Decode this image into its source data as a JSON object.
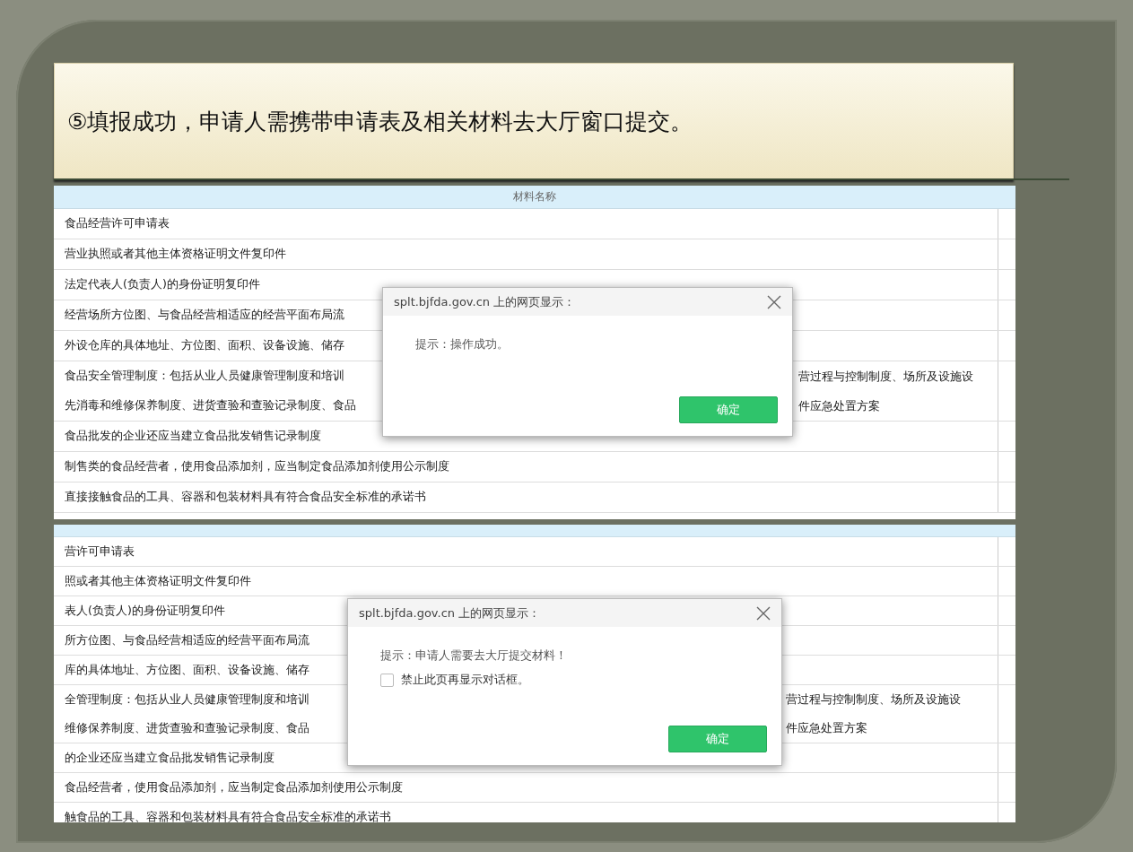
{
  "slide": {
    "title": "⑤填报成功，申请人需携带申请表及相关材料去大厅窗口提交。"
  },
  "screenshots": [
    {
      "header": "材料名称",
      "rows": [
        {
          "lines": [
            {
              "left": "食品经营许可申请表"
            }
          ]
        },
        {
          "lines": [
            {
              "left": "营业执照或者其他主体资格证明文件复印件"
            }
          ]
        },
        {
          "lines": [
            {
              "left": "法定代表人(负责人)的身份证明复印件"
            }
          ]
        },
        {
          "lines": [
            {
              "left": "经营场所方位图、与食品经营相适应的经营平面布局流"
            }
          ]
        },
        {
          "lines": [
            {
              "left": "外设仓库的具体地址、方位图、面积、设备设施、储存"
            }
          ]
        },
        {
          "lines": [
            {
              "left": "食品安全管理制度：包括从业人员健康管理制度和培训",
              "right": "营过程与控制制度、场所及设施设"
            },
            {
              "left": "先消毒和维修保养制度、进货查验和查验记录制度、食品",
              "right": "件应急处置方案"
            }
          ]
        },
        {
          "lines": [
            {
              "left": "食品批发的企业还应当建立食品批发销售记录制度"
            }
          ]
        },
        {
          "lines": [
            {
              "left": "制售类的食品经营者，使用食品添加剂，应当制定食品添加剂使用公示制度"
            }
          ]
        },
        {
          "lines": [
            {
              "left": "直接接触食品的工具、容器和包装材料具有符合食品安全标准的承诺书"
            }
          ]
        }
      ],
      "dialog": {
        "title": "splt.bjfda.gov.cn 上的网页显示：",
        "message": "提示：操作成功。",
        "button": "确定"
      }
    },
    {
      "rows": [
        {
          "lines": [
            {
              "left": "营许可申请表"
            }
          ]
        },
        {
          "lines": [
            {
              "left": "照或者其他主体资格证明文件复印件"
            }
          ]
        },
        {
          "lines": [
            {
              "left": "表人(负责人)的身份证明复印件"
            }
          ]
        },
        {
          "lines": [
            {
              "left": "所方位图、与食品经营相适应的经营平面布局流"
            }
          ]
        },
        {
          "lines": [
            {
              "left": "库的具体地址、方位图、面积、设备设施、储存"
            }
          ]
        },
        {
          "lines": [
            {
              "left": "全管理制度：包括从业人员健康管理制度和培训",
              "right": "营过程与控制制度、场所及设施设"
            },
            {
              "left": "维修保养制度、进货查验和查验记录制度、食品",
              "right": "件应急处置方案"
            }
          ]
        },
        {
          "lines": [
            {
              "left": "的企业还应当建立食品批发销售记录制度"
            }
          ]
        },
        {
          "lines": [
            {
              "left": "食品经营者，使用食品添加剂，应当制定食品添加剂使用公示制度"
            }
          ]
        },
        {
          "lines": [
            {
              "left": "触食品的工具、容器和包装材料具有符合食品安全标准的承诺书"
            }
          ]
        }
      ],
      "dialog": {
        "title": "splt.bjfda.gov.cn 上的网页显示：",
        "message": "提示：申请人需要去大厅提交材料！",
        "checkbox": {
          "label": "禁止此页再显示对话框。",
          "checked": false
        },
        "button": "确定"
      }
    }
  ]
}
